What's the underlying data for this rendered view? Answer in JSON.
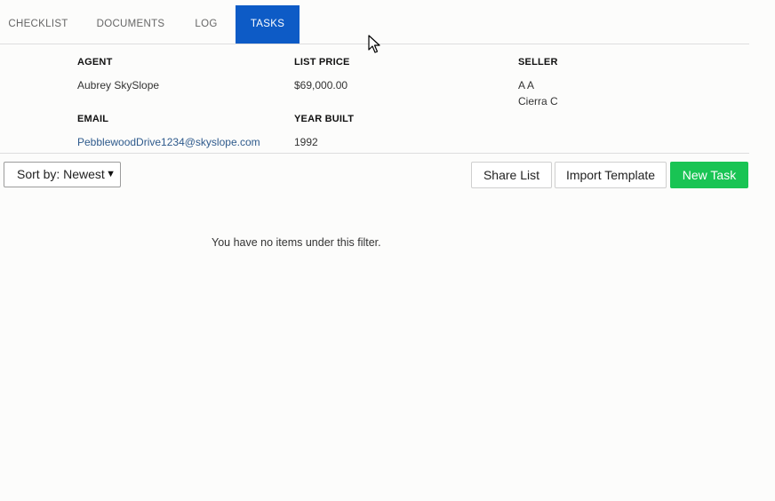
{
  "tabs": [
    {
      "label": "CHECKLIST",
      "active": false
    },
    {
      "label": "DOCUMENTS",
      "active": false
    },
    {
      "label": "LOG",
      "active": false
    },
    {
      "label": "TASKS",
      "active": true
    }
  ],
  "details": {
    "agent": {
      "label": "AGENT",
      "value": "Aubrey SkySlope"
    },
    "list_price": {
      "label": "LIST PRICE",
      "value": "$69,000.00"
    },
    "seller": {
      "label": "SELLER",
      "values": [
        "A A",
        "Cierra C"
      ]
    },
    "email": {
      "label": "EMAIL",
      "value": "PebblewoodDrive1234@skyslope.com"
    },
    "year_built": {
      "label": "YEAR BUILT",
      "value": "1992"
    }
  },
  "toolbar": {
    "sort_label": "Sort by: Newest",
    "share_label": "Share List",
    "import_label": "Import Template",
    "new_task_label": "New Task"
  },
  "empty_message": "You have no items under this filter.",
  "colors": {
    "active_tab": "#0d5bc6",
    "primary_button": "#19c454",
    "link": "#2e5a8c"
  }
}
